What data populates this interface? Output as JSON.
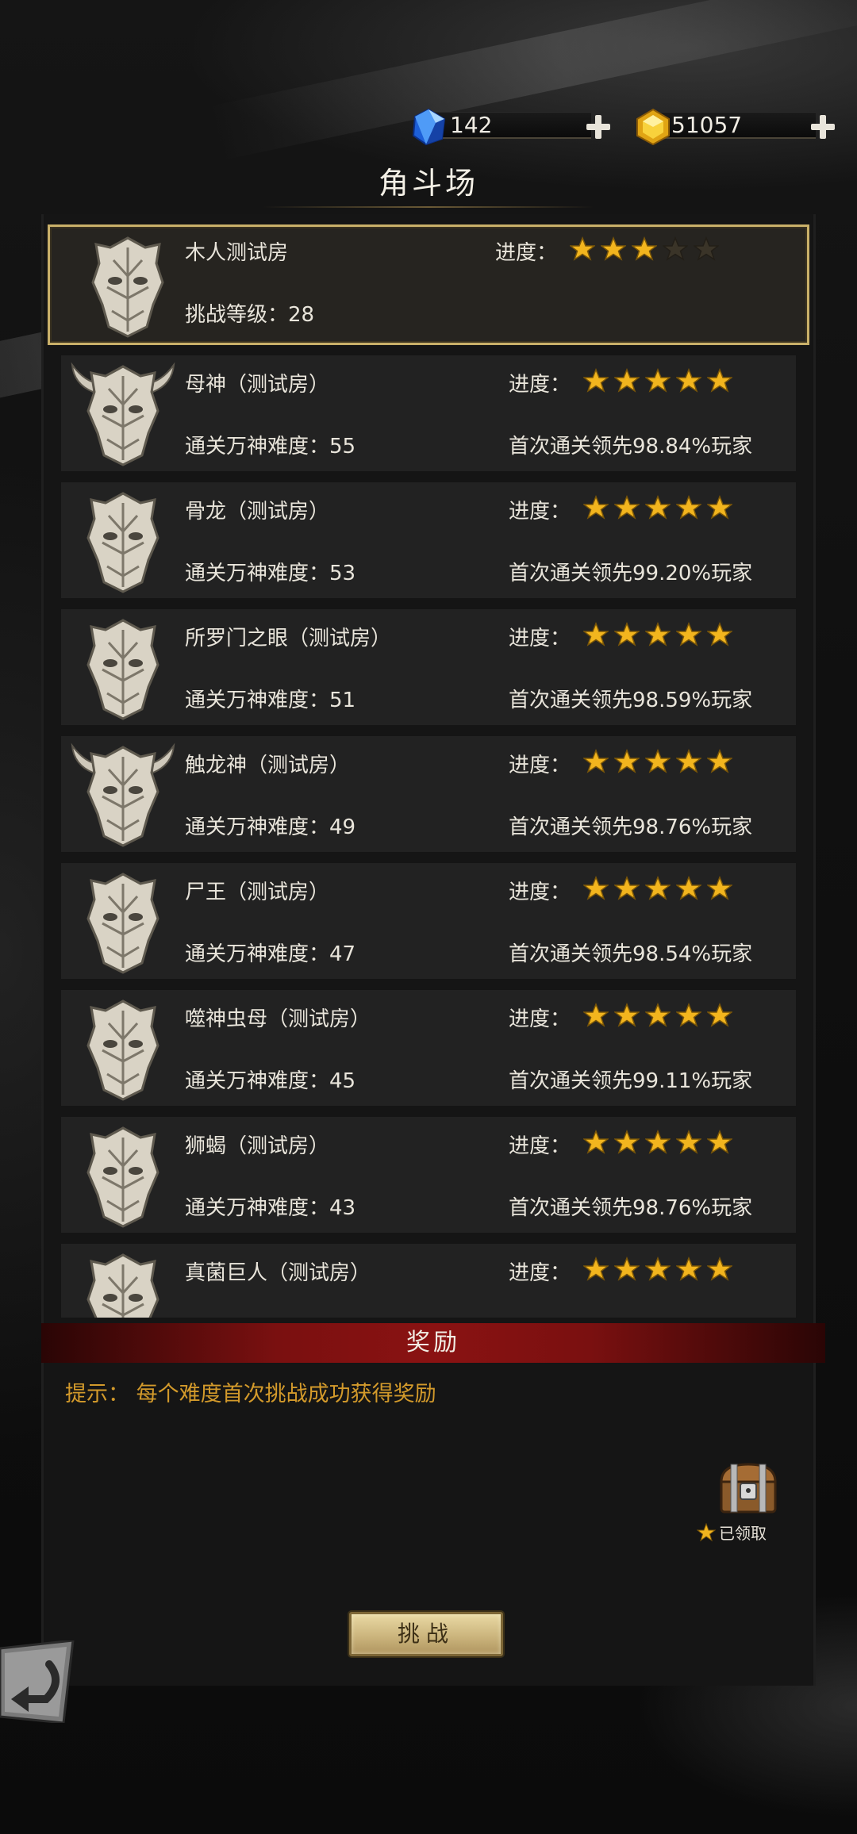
{
  "currency": {
    "gems": "142",
    "gold": "51057",
    "gem_icon": "blue-crystal-icon",
    "gold_icon": "gold-crystal-icon"
  },
  "title": "角斗场",
  "stages": [
    {
      "name": "木人测试房",
      "level": "挑战等级：28",
      "progress_label": "进度：",
      "stars": 3,
      "max_stars": 5,
      "lead": "",
      "horned": false,
      "selected": true
    },
    {
      "name": "母神（测试房）",
      "level": "通关万神难度：55",
      "progress_label": "进度：",
      "stars": 5,
      "max_stars": 5,
      "lead": "首次通关领先98.84%玩家",
      "horned": true,
      "selected": false
    },
    {
      "name": "骨龙（测试房）",
      "level": "通关万神难度：53",
      "progress_label": "进度：",
      "stars": 5,
      "max_stars": 5,
      "lead": "首次通关领先99.20%玩家",
      "horned": false,
      "selected": false
    },
    {
      "name": "所罗门之眼（测试房）",
      "level": "通关万神难度：51",
      "progress_label": "进度：",
      "stars": 5,
      "max_stars": 5,
      "lead": "首次通关领先98.59%玩家",
      "horned": false,
      "selected": false
    },
    {
      "name": "触龙神（测试房）",
      "level": "通关万神难度：49",
      "progress_label": "进度：",
      "stars": 5,
      "max_stars": 5,
      "lead": "首次通关领先98.76%玩家",
      "horned": true,
      "selected": false
    },
    {
      "name": "尸王（测试房）",
      "level": "通关万神难度：47",
      "progress_label": "进度：",
      "stars": 5,
      "max_stars": 5,
      "lead": "首次通关领先98.54%玩家",
      "horned": false,
      "selected": false
    },
    {
      "name": "噬神虫母（测试房）",
      "level": "通关万神难度：45",
      "progress_label": "进度：",
      "stars": 5,
      "max_stars": 5,
      "lead": "首次通关领先99.11%玩家",
      "horned": false,
      "selected": false
    },
    {
      "name": "狮蝎（测试房）",
      "level": "通关万神难度：43",
      "progress_label": "进度：",
      "stars": 5,
      "max_stars": 5,
      "lead": "首次通关领先98.76%玩家",
      "horned": false,
      "selected": false
    },
    {
      "name": "真菌巨人（测试房）",
      "level": "",
      "progress_label": "进度：",
      "stars": 5,
      "max_stars": 5,
      "lead": "",
      "horned": false,
      "selected": false
    }
  ],
  "reward": {
    "header": "奖励",
    "hint": "提示：  每个难度首次挑战成功获得奖励",
    "claimed_label": "已领取",
    "chest_icon": "treasure-chest-icon"
  },
  "challenge_label": "挑战",
  "back_icon": "back-arrow-icon",
  "colors": {
    "gold_star": "#f2b51e",
    "empty_star": "#3a3428",
    "selected_border": "#c9b069",
    "reward_header": "#8a1212",
    "hint": "#d39a2b"
  }
}
